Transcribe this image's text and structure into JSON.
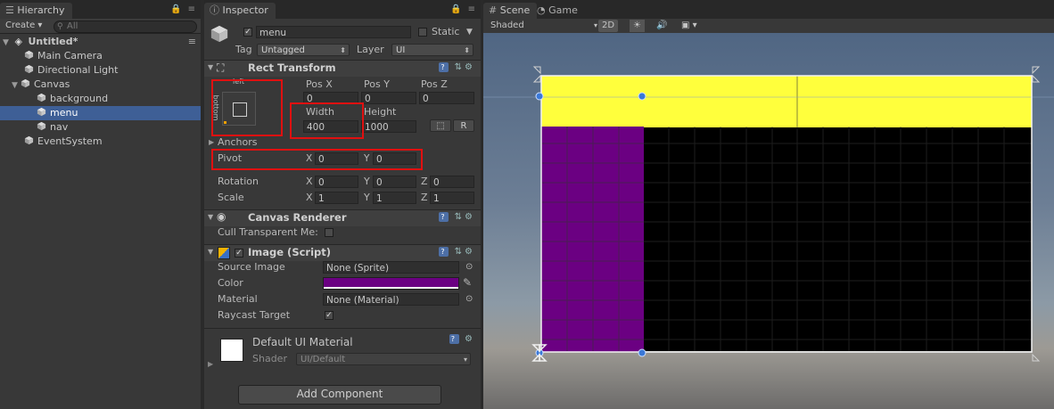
{
  "hierarchy": {
    "tab": "Hierarchy",
    "create_label": "Create",
    "search_placeholder": "All",
    "scene_name": "Untitled*",
    "items": [
      "Main Camera",
      "Directional Light",
      "Canvas",
      "background",
      "menu",
      "nav",
      "EventSystem"
    ]
  },
  "inspector": {
    "tab": "Inspector",
    "object_name": "menu",
    "static_label": "Static",
    "tag_label": "Tag",
    "tag_value": "Untagged",
    "layer_label": "Layer",
    "layer_value": "UI",
    "rect_transform": {
      "title": "Rect Transform",
      "anchor_preset_top": "left",
      "anchor_preset_side": "bottom",
      "pos_x_label": "Pos X",
      "pos_y_label": "Pos Y",
      "pos_z_label": "Pos Z",
      "pos_x": "0",
      "pos_y": "0",
      "pos_z": "0",
      "width_label": "Width",
      "height_label": "Height",
      "width": "400",
      "height": "1000",
      "r_label": "R",
      "anchors_label": "Anchors",
      "pivot_label": "Pivot",
      "pivot_x": "0",
      "pivot_y": "0",
      "rotation_label": "Rotation",
      "rot_x": "0",
      "rot_y": "0",
      "rot_z": "0",
      "scale_label": "Scale",
      "scale_x": "1",
      "scale_y": "1",
      "scale_z": "1",
      "x_label": "X",
      "y_label": "Y",
      "z_label": "Z"
    },
    "canvas_renderer": {
      "title": "Canvas Renderer",
      "cull_label": "Cull Transparent Me:"
    },
    "image": {
      "title": "Image (Script)",
      "source_label": "Source Image",
      "source_value": "None (Sprite)",
      "color_label": "Color",
      "color_value": "#6b0082",
      "material_label": "Material",
      "material_value": "None (Material)",
      "raycast_label": "Raycast Target"
    },
    "material": {
      "name": "Default UI Material",
      "shader_label": "Shader",
      "shader_value": "UI/Default"
    },
    "add_component": "Add Component"
  },
  "scene": {
    "tab_scene": "Scene",
    "tab_game": "Game",
    "shading": "Shaded",
    "mode_2d": "2D",
    "colors": {
      "yellow": "#ffff3c",
      "purple": "#6b0082",
      "black": "#000000"
    }
  }
}
